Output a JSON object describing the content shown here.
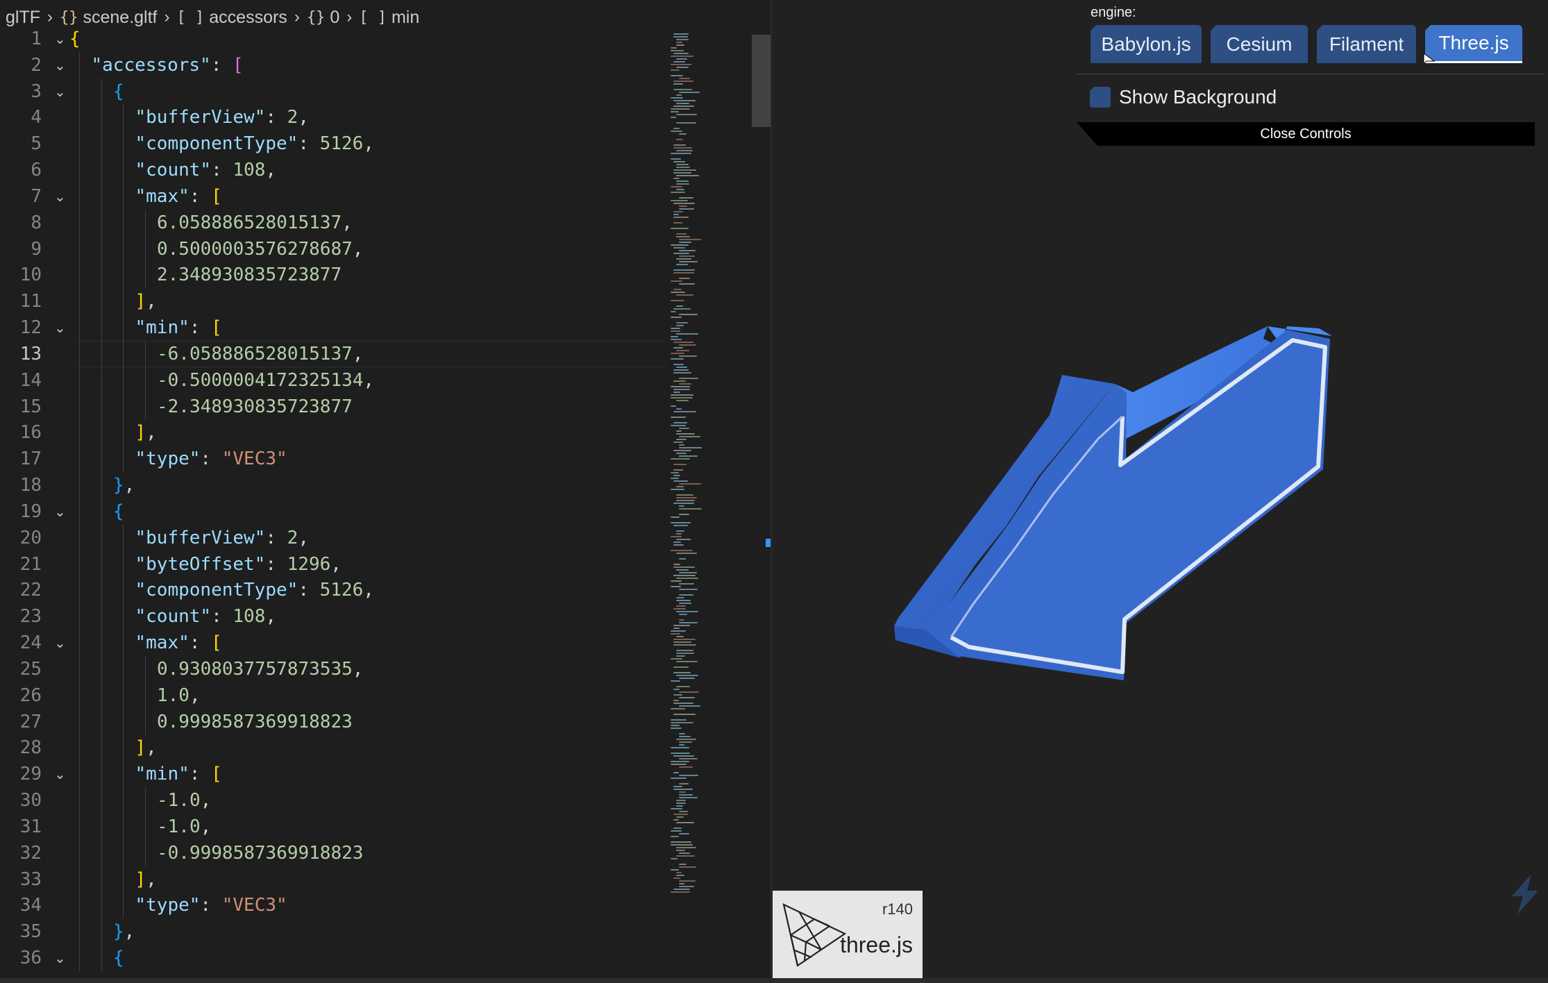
{
  "breadcrumb": [
    {
      "icon": "",
      "label": "glTF"
    },
    {
      "icon": "{}",
      "label": "scene.gltf"
    },
    {
      "icon": "[ ]",
      "label": "accessors"
    },
    {
      "icon": "{}",
      "label": "0"
    },
    {
      "icon": "[ ]",
      "label": "min"
    }
  ],
  "editor": {
    "current_line": 13,
    "lines": [
      {
        "n": "1",
        "fold": "⌄",
        "indent": 0,
        "tokens": [
          [
            "b1",
            "{"
          ]
        ]
      },
      {
        "n": "2",
        "fold": "⌄",
        "indent": 1,
        "tokens": [
          [
            "k",
            "\"accessors\""
          ],
          [
            "p",
            ": "
          ],
          [
            "b2",
            "["
          ]
        ]
      },
      {
        "n": "3",
        "fold": "⌄",
        "indent": 2,
        "tokens": [
          [
            "b3",
            "{"
          ]
        ]
      },
      {
        "n": "4",
        "fold": "",
        "indent": 3,
        "tokens": [
          [
            "k",
            "\"bufferView\""
          ],
          [
            "p",
            ": "
          ],
          [
            "n",
            "2"
          ],
          [
            "p",
            ","
          ]
        ]
      },
      {
        "n": "5",
        "fold": "",
        "indent": 3,
        "tokens": [
          [
            "k",
            "\"componentType\""
          ],
          [
            "p",
            ": "
          ],
          [
            "n",
            "5126"
          ],
          [
            "p",
            ","
          ]
        ]
      },
      {
        "n": "6",
        "fold": "",
        "indent": 3,
        "tokens": [
          [
            "k",
            "\"count\""
          ],
          [
            "p",
            ": "
          ],
          [
            "n",
            "108"
          ],
          [
            "p",
            ","
          ]
        ]
      },
      {
        "n": "7",
        "fold": "⌄",
        "indent": 3,
        "tokens": [
          [
            "k",
            "\"max\""
          ],
          [
            "p",
            ": "
          ],
          [
            "b1",
            "["
          ]
        ]
      },
      {
        "n": "8",
        "fold": "",
        "indent": 4,
        "tokens": [
          [
            "n",
            "6.058886528015137"
          ],
          [
            "p",
            ","
          ]
        ]
      },
      {
        "n": "9",
        "fold": "",
        "indent": 4,
        "tokens": [
          [
            "n",
            "0.5000003576278687"
          ],
          [
            "p",
            ","
          ]
        ]
      },
      {
        "n": "10",
        "fold": "",
        "indent": 4,
        "tokens": [
          [
            "n",
            "2.348930835723877"
          ]
        ]
      },
      {
        "n": "11",
        "fold": "",
        "indent": 3,
        "tokens": [
          [
            "b1",
            "]"
          ],
          [
            "p",
            ","
          ]
        ]
      },
      {
        "n": "12",
        "fold": "⌄",
        "indent": 3,
        "tokens": [
          [
            "k",
            "\"min\""
          ],
          [
            "p",
            ": "
          ],
          [
            "b1",
            "["
          ]
        ]
      },
      {
        "n": "13",
        "fold": "",
        "indent": 4,
        "tokens": [
          [
            "n",
            "-6.058886528015137"
          ],
          [
            "p",
            ","
          ]
        ]
      },
      {
        "n": "14",
        "fold": "",
        "indent": 4,
        "tokens": [
          [
            "n",
            "-0.5000004172325134"
          ],
          [
            "p",
            ","
          ]
        ]
      },
      {
        "n": "15",
        "fold": "",
        "indent": 4,
        "tokens": [
          [
            "n",
            "-2.348930835723877"
          ]
        ]
      },
      {
        "n": "16",
        "fold": "",
        "indent": 3,
        "tokens": [
          [
            "b1",
            "]"
          ],
          [
            "p",
            ","
          ]
        ]
      },
      {
        "n": "17",
        "fold": "",
        "indent": 3,
        "tokens": [
          [
            "k",
            "\"type\""
          ],
          [
            "p",
            ": "
          ],
          [
            "s",
            "\"VEC3\""
          ]
        ]
      },
      {
        "n": "18",
        "fold": "",
        "indent": 2,
        "tokens": [
          [
            "b3",
            "}"
          ],
          [
            "p",
            ","
          ]
        ]
      },
      {
        "n": "19",
        "fold": "⌄",
        "indent": 2,
        "tokens": [
          [
            "b3",
            "{"
          ]
        ]
      },
      {
        "n": "20",
        "fold": "",
        "indent": 3,
        "tokens": [
          [
            "k",
            "\"bufferView\""
          ],
          [
            "p",
            ": "
          ],
          [
            "n",
            "2"
          ],
          [
            "p",
            ","
          ]
        ]
      },
      {
        "n": "21",
        "fold": "",
        "indent": 3,
        "tokens": [
          [
            "k",
            "\"byteOffset\""
          ],
          [
            "p",
            ": "
          ],
          [
            "n",
            "1296"
          ],
          [
            "p",
            ","
          ]
        ]
      },
      {
        "n": "22",
        "fold": "",
        "indent": 3,
        "tokens": [
          [
            "k",
            "\"componentType\""
          ],
          [
            "p",
            ": "
          ],
          [
            "n",
            "5126"
          ],
          [
            "p",
            ","
          ]
        ]
      },
      {
        "n": "23",
        "fold": "",
        "indent": 3,
        "tokens": [
          [
            "k",
            "\"count\""
          ],
          [
            "p",
            ": "
          ],
          [
            "n",
            "108"
          ],
          [
            "p",
            ","
          ]
        ]
      },
      {
        "n": "24",
        "fold": "⌄",
        "indent": 3,
        "tokens": [
          [
            "k",
            "\"max\""
          ],
          [
            "p",
            ": "
          ],
          [
            "b1",
            "["
          ]
        ]
      },
      {
        "n": "25",
        "fold": "",
        "indent": 4,
        "tokens": [
          [
            "n",
            "0.9308037757873535"
          ],
          [
            "p",
            ","
          ]
        ]
      },
      {
        "n": "26",
        "fold": "",
        "indent": 4,
        "tokens": [
          [
            "n",
            "1.0"
          ],
          [
            "p",
            ","
          ]
        ]
      },
      {
        "n": "27",
        "fold": "",
        "indent": 4,
        "tokens": [
          [
            "n",
            "0.9998587369918823"
          ]
        ]
      },
      {
        "n": "28",
        "fold": "",
        "indent": 3,
        "tokens": [
          [
            "b1",
            "]"
          ],
          [
            "p",
            ","
          ]
        ]
      },
      {
        "n": "29",
        "fold": "⌄",
        "indent": 3,
        "tokens": [
          [
            "k",
            "\"min\""
          ],
          [
            "p",
            ": "
          ],
          [
            "b1",
            "["
          ]
        ]
      },
      {
        "n": "30",
        "fold": "",
        "indent": 4,
        "tokens": [
          [
            "n",
            "-1.0"
          ],
          [
            "p",
            ","
          ]
        ]
      },
      {
        "n": "31",
        "fold": "",
        "indent": 4,
        "tokens": [
          [
            "n",
            "-1.0"
          ],
          [
            "p",
            ","
          ]
        ]
      },
      {
        "n": "32",
        "fold": "",
        "indent": 4,
        "tokens": [
          [
            "n",
            "-0.9998587369918823"
          ]
        ]
      },
      {
        "n": "33",
        "fold": "",
        "indent": 3,
        "tokens": [
          [
            "b1",
            "]"
          ],
          [
            "p",
            ","
          ]
        ]
      },
      {
        "n": "34",
        "fold": "",
        "indent": 3,
        "tokens": [
          [
            "k",
            "\"type\""
          ],
          [
            "p",
            ": "
          ],
          [
            "s",
            "\"VEC3\""
          ]
        ]
      },
      {
        "n": "35",
        "fold": "",
        "indent": 2,
        "tokens": [
          [
            "b3",
            "}"
          ],
          [
            "p",
            ","
          ]
        ]
      },
      {
        "n": "36",
        "fold": "⌄",
        "indent": 2,
        "tokens": [
          [
            "b3",
            "{"
          ]
        ]
      }
    ]
  },
  "viewer": {
    "engine_label": "engine:",
    "engines": [
      "Babylon.js",
      "Cesium",
      "Filament",
      "Three.js"
    ],
    "active_engine": "Three.js",
    "show_background_label": "Show Background",
    "show_background_checked": false,
    "close_controls_label": "Close Controls",
    "version": "r140",
    "brand": "three.js"
  },
  "colors": {
    "editor_bg": "#1e1e1e",
    "viewer_bg": "#212121",
    "button_bg": "#2d4f83",
    "button_active_bg": "#3e74c9",
    "arrow_blue": "#3d72d8"
  },
  "icons": [
    "chevron-right-icon",
    "json-braces-icon",
    "array-brackets-icon",
    "fold-chevron-icon",
    "threejs-logo-icon",
    "cursor-icon",
    "stackblitz-icon"
  ]
}
